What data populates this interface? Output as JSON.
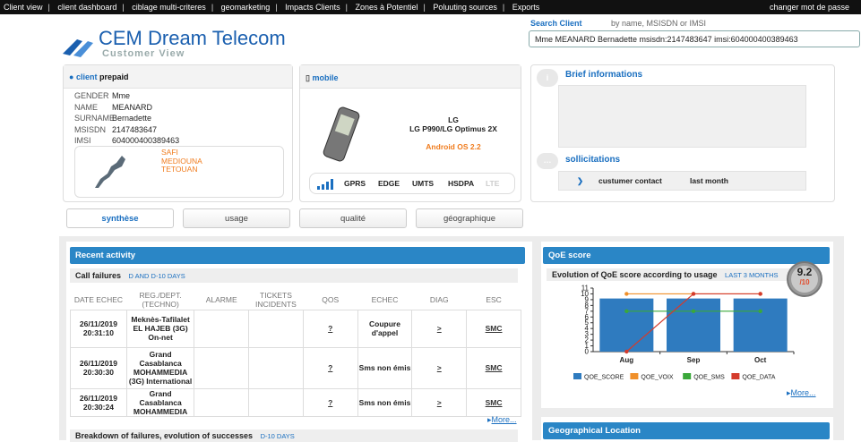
{
  "nav": {
    "items": [
      "Client view",
      "client dashboard",
      "ciblage multi-criteres",
      "geomarketing",
      "Impacts Clients",
      "Zones à Potentiel",
      "Poluuting sources",
      "Exports"
    ],
    "change_password": "changer mot de passe"
  },
  "search": {
    "label": "Search Client",
    "hint": "by name, MSISDN or IMSI",
    "value": "Mme MEANARD Bernadette msisdn:2147483647 imsi:604000400389463"
  },
  "brand": {
    "title": "CEM Dream Telecom",
    "subtitle": "Customer View"
  },
  "client": {
    "header_label": "client",
    "type": "prepaid",
    "fields": [
      {
        "k": "GENDER",
        "v": "Mme"
      },
      {
        "k": "NAME",
        "v": "MEANARD"
      },
      {
        "k": "SURNAME",
        "v": "Bernadette"
      },
      {
        "k": "MSISDN",
        "v": "2147483647"
      },
      {
        "k": "IMSI",
        "v": "604000400389463"
      }
    ],
    "cities": [
      "SAFI",
      "MEDIOUNA",
      "TETOUAN"
    ]
  },
  "mobile": {
    "header_label": "mobile",
    "brand": "LG",
    "model": "LG P990/LG Optimus 2X",
    "os": "Android OS 2.2",
    "networks": [
      "GPRS",
      "EDGE",
      "UMTS",
      "HSDPA",
      "LTE"
    ]
  },
  "brief": {
    "title": "Brief informations"
  },
  "sollicitations": {
    "title": "sollicitations",
    "col1": "custumer contact",
    "col2": "last month"
  },
  "tabs": [
    "synthèse",
    "usage",
    "qualité",
    "géographique"
  ],
  "recent": {
    "title": "Recent activity",
    "sub_title": "Call failures",
    "sub_range": "D AND D-10 DAYS",
    "headers": [
      "DATE ECHEC",
      "REG./DEPT. (TECHNO)",
      "ALARME",
      "TICKETS INCIDENTS",
      "QOS",
      "ECHEC",
      "DIAG",
      "ESC"
    ],
    "rows": [
      {
        "date": "26/11/2019 20:31:10",
        "reg": "Meknès-Tafilalet EL HAJEB (3G) On-net",
        "qos": "?",
        "echec": "Coupure d'appel",
        "diag": ">",
        "esc": "SMC"
      },
      {
        "date": "26/11/2019 20:30:30",
        "reg": "Grand Casablanca MOHAMMEDIA (3G) International",
        "qos": "?",
        "echec": "Sms non émis",
        "diag": ">",
        "esc": "SMC"
      },
      {
        "date": "26/11/2019 20:30:24",
        "reg": "Grand Casablanca MOHAMMEDIA",
        "qos": "?",
        "echec": "Sms non émis",
        "diag": ">",
        "esc": "SMC"
      }
    ],
    "more": "More...",
    "next_title": "Breakdown of failures, evolution of successes",
    "next_range": "D-10 DAYS"
  },
  "qoe": {
    "title": "QoE score",
    "sub_title": "Evolution of QoE score according to usage",
    "sub_range": "LAST 3 MONTHS",
    "score": "9.2",
    "score_den": "/10",
    "more": "More...",
    "geo_title": "Geographical Location"
  },
  "chart_data": {
    "type": "bar",
    "categories": [
      "Aug",
      "Sep",
      "Oct"
    ],
    "ylim": [
      0,
      11
    ],
    "yticks": [
      0,
      1,
      2,
      3,
      4,
      5,
      6,
      7,
      8,
      9,
      10,
      11
    ],
    "series": [
      {
        "name": "QOE_SCORE",
        "kind": "bar",
        "color": "#2f7bbf",
        "values": [
          9.2,
          9.2,
          9.2
        ]
      },
      {
        "name": "QOE_VOIX",
        "kind": "line",
        "color": "#f0902a",
        "values": [
          10,
          10,
          10
        ]
      },
      {
        "name": "QOE_SMS",
        "kind": "line",
        "color": "#3aa83a",
        "values": [
          7,
          7,
          7
        ]
      },
      {
        "name": "QOE_DATA",
        "kind": "line",
        "color": "#d43b2c",
        "values": [
          0,
          10,
          10
        ]
      }
    ]
  }
}
